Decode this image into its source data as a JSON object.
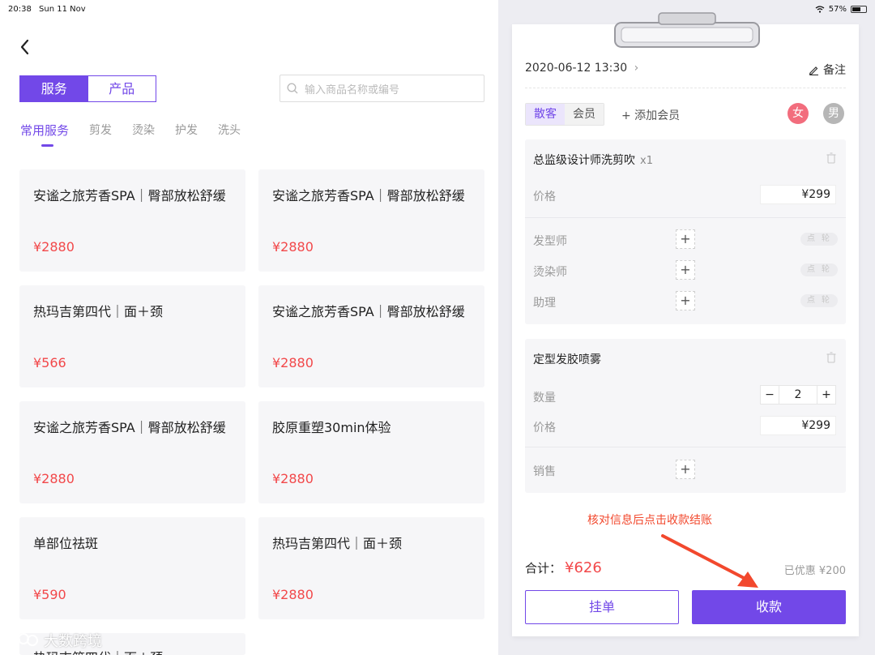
{
  "status_bar": {
    "time": "20:38",
    "date": "Sun 11 Nov",
    "battery": "57%"
  },
  "left": {
    "segment": {
      "service": "服务",
      "product": "产品"
    },
    "search": {
      "placeholder": "输入商品名称或编号"
    },
    "categories": [
      "常用服务",
      "剪发",
      "烫染",
      "护发",
      "洗头"
    ],
    "cards": [
      {
        "title": "安谧之旅芳香SPA｜臀部放松舒缓",
        "price": "¥2880"
      },
      {
        "title": "安谧之旅芳香SPA｜臀部放松舒缓",
        "price": "¥2880"
      },
      {
        "title": "热玛吉第四代｜面＋颈",
        "price": "¥566"
      },
      {
        "title": "安谧之旅芳香SPA｜臀部放松舒缓",
        "price": "¥2880"
      },
      {
        "title": "安谧之旅芳香SPA｜臀部放松舒缓",
        "price": "¥2880"
      },
      {
        "title": "胶原重塑30min体验",
        "price": "¥2880"
      },
      {
        "title": "单部位祛斑",
        "price": "¥590"
      },
      {
        "title": "热玛吉第四代｜面＋颈",
        "price": "¥2880"
      },
      {
        "title": "热玛吉第四代｜面＋颈",
        "price": ""
      }
    ]
  },
  "order": {
    "datetime": "2020-06-12 13:30",
    "note_label": "备注",
    "customer_types": [
      "散客",
      "会员"
    ],
    "add_member": "+ 添加会员",
    "gender_female": "女",
    "gender_male": "男",
    "item1": {
      "name": "总监级设计师洗剪吹",
      "qty": "x1",
      "price_label": "价格",
      "price": "¥299",
      "roles": [
        "发型师",
        "烫染师",
        "助理"
      ],
      "pill": "点轮"
    },
    "item2": {
      "name": "定型发胶喷雾",
      "qty_label": "数量",
      "qty_value": "2",
      "minus": "−",
      "plus": "+",
      "price_label": "价格",
      "price": "¥299",
      "sales_label": "销售"
    },
    "hint": "核对信息后点击收款结账",
    "total_label": "合计：",
    "total_amount": "¥626",
    "discount": "已优惠  ¥200",
    "hold_button": "挂单",
    "pay_button": "收款"
  },
  "watermark": "大数跨境",
  "colors": {
    "accent": "#7248e8",
    "price": "#f2484a",
    "hint": "#f2482d"
  }
}
